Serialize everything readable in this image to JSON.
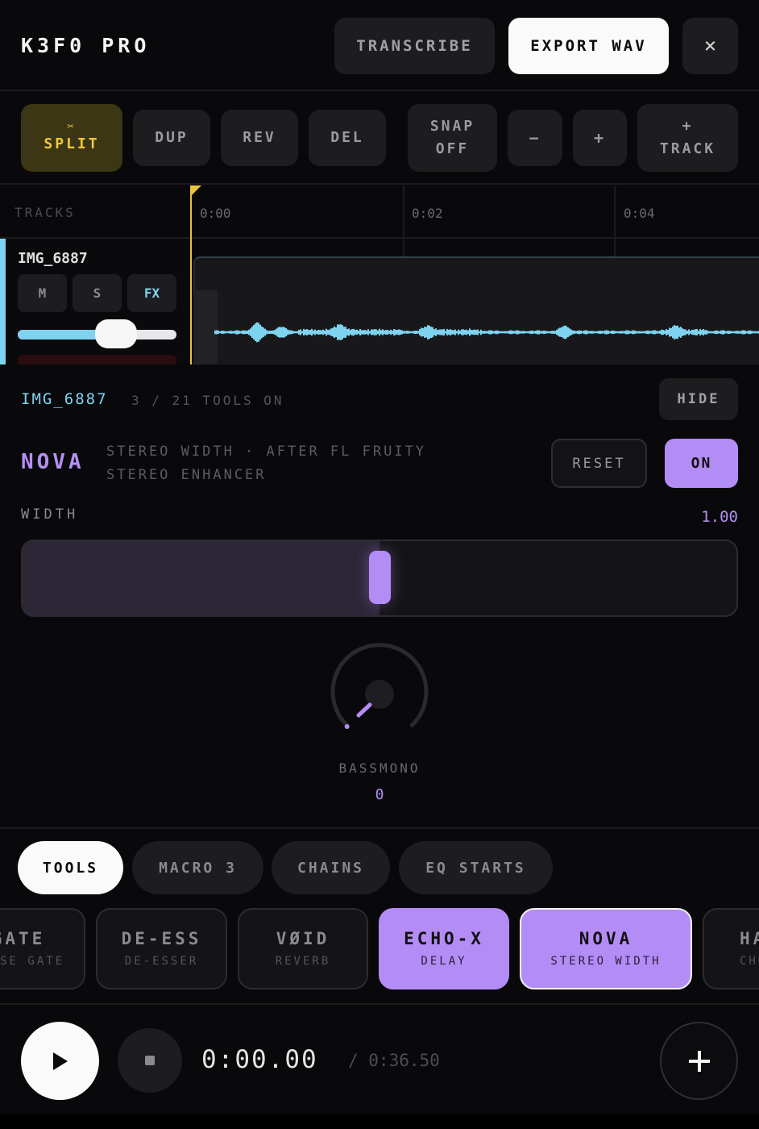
{
  "header": {
    "app_title": "K3F0 PRO",
    "transcribe_label": "TRANSCRIBE",
    "export_label": "EXPORT WAV",
    "close_label": "×"
  },
  "toolbar": {
    "split_icon": "✂",
    "split_label": "SPLIT",
    "dup_label": "DUP",
    "rev_label": "REV",
    "del_label": "DEL",
    "snap_line1": "SNAP",
    "snap_line2": "OFF",
    "zoom_out_label": "−",
    "zoom_in_label": "+",
    "add_track_line1": "+",
    "add_track_line2": "TRACK"
  },
  "timeline": {
    "tracks_label": "TRACKS",
    "ticks": [
      "0:00",
      "0:02",
      "0:04"
    ]
  },
  "track": {
    "name": "IMG_6887",
    "mute_label": "M",
    "solo_label": "S",
    "fx_label": "FX",
    "volume": 0.62,
    "accent_color": "#7dd3f0"
  },
  "fx_panel": {
    "track_name": "IMG_6887",
    "tools_count": "3 / 21 TOOLS ON",
    "hide_label": "HIDE",
    "plugin_name": "NOVA",
    "plugin_description": "STEREO WIDTH · AFTER FL FRUITY STEREO ENHANCER",
    "reset_label": "RESET",
    "on_label": "ON",
    "param_label": "WIDTH",
    "param_value": "1.00",
    "width_fraction": 0.5,
    "knob_label": "BASSMONO",
    "knob_value": "0",
    "accent_color": "#b48cf6"
  },
  "tabs": [
    {
      "label": "TOOLS",
      "active": true
    },
    {
      "label": "MACRO 3",
      "active": false
    },
    {
      "label": "CHAINS",
      "active": false
    },
    {
      "label": "EQ STARTS",
      "active": false
    }
  ],
  "tools": [
    {
      "name": "GATE",
      "sub": "NOISE GATE",
      "visible_name": "ATE",
      "visible_sub": "E GATE"
    },
    {
      "name": "DE-ESS",
      "sub": "DE-ESSER"
    },
    {
      "name": "VØID",
      "sub": "REVERB"
    },
    {
      "name": "ECHO-X",
      "sub": "DELAY",
      "active": true
    },
    {
      "name": "NOVA",
      "sub": "STEREO WIDTH",
      "active": true,
      "selected": true
    },
    {
      "name": "HA",
      "sub": "CHO",
      "visible_name": "HA",
      "visible_sub": "CHO"
    }
  ],
  "transport": {
    "play_icon": "play-icon",
    "stop_icon": "stop-icon",
    "current_time": "0:00.00",
    "total_time": "/ 0:36.50",
    "add_icon": "plus-icon"
  }
}
